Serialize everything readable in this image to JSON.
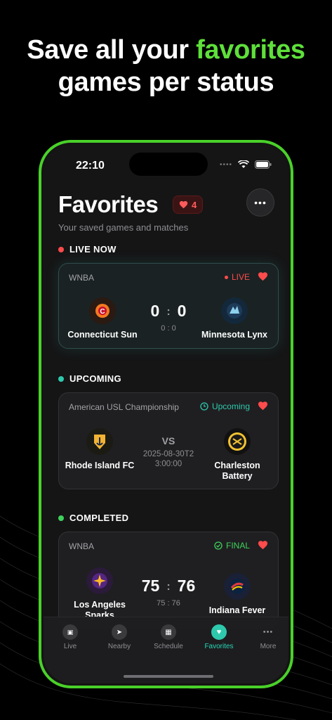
{
  "headline": {
    "line1_prefix": "Save all your ",
    "line1_accent": "favorites",
    "line2": "games per status"
  },
  "colors": {
    "accent_green": "#5ee03a",
    "live_red": "#ff4b4b",
    "teal": "#2ec9ad",
    "completed_green": "#3fd15b"
  },
  "status_bar": {
    "time": "22:10"
  },
  "header": {
    "title": "Favorites",
    "badge_count": "4",
    "subtitle": "Your saved games and matches"
  },
  "sections": {
    "live": {
      "label": "LIVE NOW",
      "card": {
        "league": "WNBA",
        "status": "LIVE",
        "home": {
          "name": "Connecticut Sun",
          "logo": "connecticut-sun-logo"
        },
        "away": {
          "name": "Minnesota Lynx",
          "logo": "minnesota-lynx-logo"
        },
        "home_score": "0",
        "away_score": "0",
        "colon": ":",
        "subscore": "0 : 0"
      }
    },
    "upcoming": {
      "label": "UPCOMING",
      "card": {
        "league": "American USL Championship",
        "status": "Upcoming",
        "home": {
          "name": "Rhode Island FC",
          "logo": "rhode-island-fc-logo"
        },
        "away": {
          "name": "Charleston Battery",
          "logo": "charleston-battery-logo"
        },
        "vs": "VS",
        "datetime_line1": "2025-08-30T2",
        "datetime_line2": "3:00:00"
      }
    },
    "completed": {
      "label": "COMPLETED",
      "card": {
        "league": "WNBA",
        "status": "FINAL",
        "home": {
          "name": "Los Angeles Sparks",
          "logo": "los-angeles-sparks-logo"
        },
        "away": {
          "name": "Indiana Fever",
          "logo": "indiana-fever-logo"
        },
        "home_score": "75",
        "away_score": "76",
        "colon": ":",
        "subscore": "75 : 76"
      }
    }
  },
  "tabs": [
    {
      "label": "Live",
      "icon": "live-icon"
    },
    {
      "label": "Nearby",
      "icon": "location-icon"
    },
    {
      "label": "Schedule",
      "icon": "calendar-icon"
    },
    {
      "label": "Favorites",
      "icon": "heart-icon"
    },
    {
      "label": "More",
      "icon": "more-icon"
    }
  ]
}
